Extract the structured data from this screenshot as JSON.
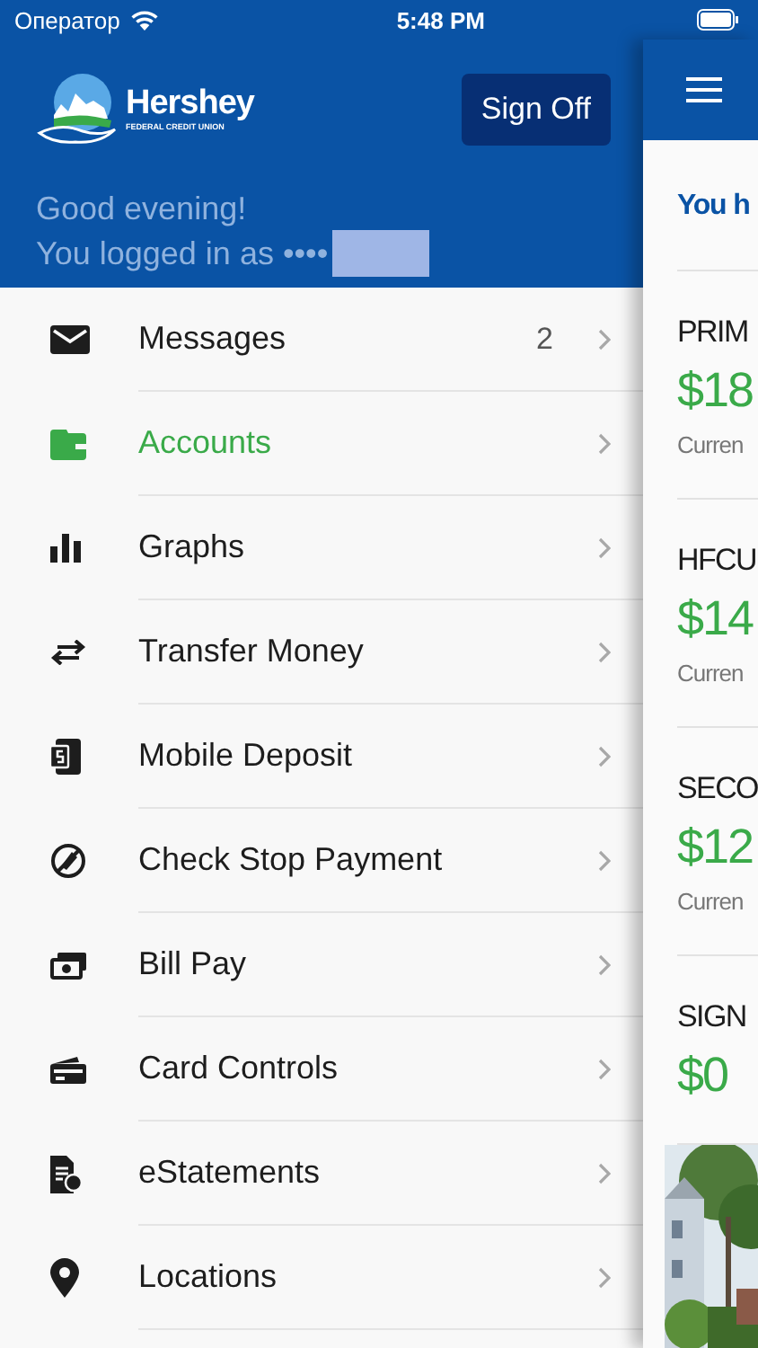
{
  "status_bar": {
    "carrier": "Оператор",
    "time": "5:48 PM"
  },
  "drawer": {
    "brand": {
      "name": "Hershey",
      "tagline": "FEDERAL CREDIT UNION"
    },
    "sign_off_button": "Sign Off",
    "greeting": "Good evening!",
    "login_text": "You logged in as ••••",
    "menu": [
      {
        "label": "Messages",
        "badge": "2",
        "selected": false
      },
      {
        "label": "Accounts",
        "selected": true
      },
      {
        "label": "Graphs",
        "selected": false
      },
      {
        "label": "Transfer Money",
        "selected": false
      },
      {
        "label": "Mobile Deposit",
        "selected": false
      },
      {
        "label": "Check Stop Payment",
        "selected": false
      },
      {
        "label": "Bill Pay",
        "selected": false
      },
      {
        "label": "Card Controls",
        "selected": false
      },
      {
        "label": "eStatements",
        "selected": false
      },
      {
        "label": "Locations",
        "selected": false
      }
    ]
  },
  "main": {
    "heading": "You h",
    "accounts": [
      {
        "name": "PRIM",
        "amount": "$18",
        "caption": "Curren"
      },
      {
        "name": "HFCU",
        "amount": "$14",
        "caption": "Curren"
      },
      {
        "name": "SECO",
        "amount": "$12",
        "caption": "Curren"
      },
      {
        "name": "SIGN",
        "amount": "$0"
      }
    ]
  }
}
